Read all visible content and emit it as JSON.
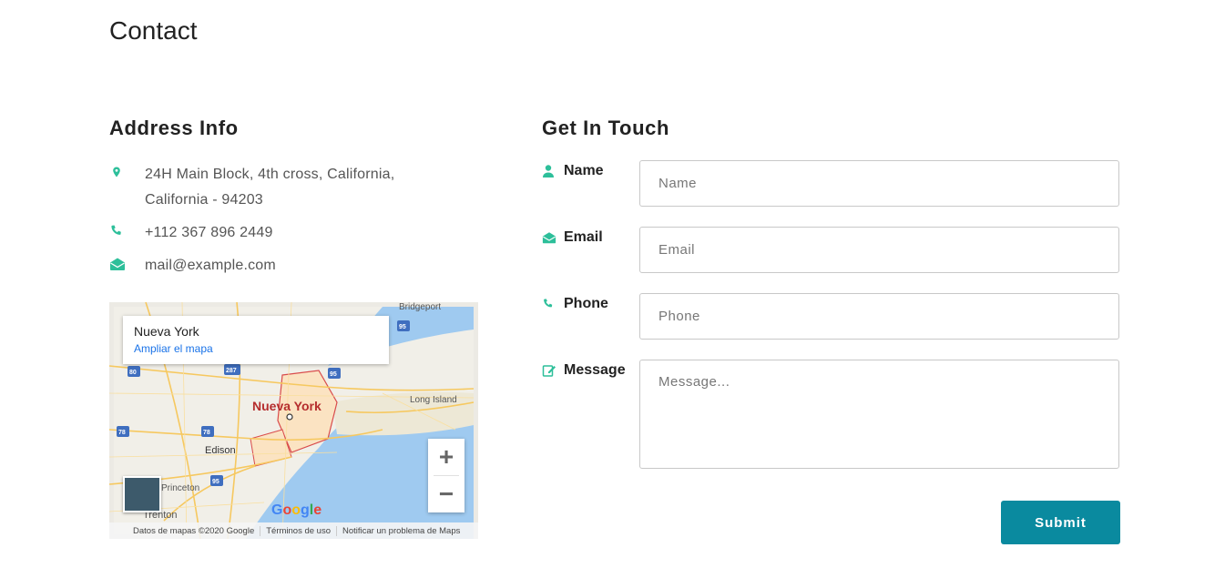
{
  "page": {
    "title": "Contact"
  },
  "address": {
    "heading": "Address Info",
    "street": "24H Main Block, 4th cross, California, California - 94203",
    "phone": "+112 367 896 2449",
    "email": "mail@example.com"
  },
  "map": {
    "place_name": "Nueva York",
    "enlarge_link": "Ampliar el mapa",
    "city_label": "Nueva York",
    "labels": [
      "Bridgeport",
      "Long Island",
      "Edison",
      "Princeton",
      "Trenton"
    ],
    "highway_shields": [
      "95",
      "80",
      "287",
      "95",
      "78",
      "78",
      "95"
    ],
    "zoom_in": "+",
    "zoom_out": "−",
    "google_logo": "Google",
    "footer": {
      "data_credit": "Datos de mapas ©2020 Google",
      "terms": "Términos de uso",
      "report": "Notificar un problema de Maps"
    }
  },
  "form": {
    "heading": "Get In Touch",
    "name_label": "Name",
    "name_placeholder": "Name",
    "email_label": "Email",
    "email_placeholder": "Email",
    "phone_label": "Phone",
    "phone_placeholder": "Phone",
    "message_label": "Message",
    "message_placeholder": "Message...",
    "submit_label": "Submit"
  },
  "colors": {
    "accent": "#2dbf9a",
    "button": "#0a8a9f",
    "link": "#1a73e8"
  },
  "icons": [
    "map-marker-icon",
    "phone-icon",
    "envelope-open-icon",
    "user-icon",
    "edit-icon"
  ]
}
